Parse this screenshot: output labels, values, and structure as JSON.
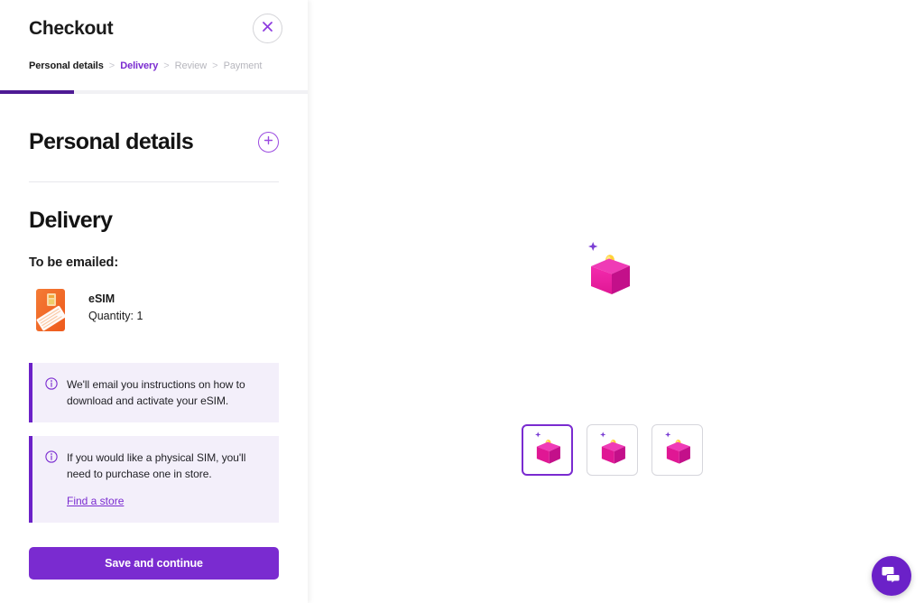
{
  "checkout": {
    "title": "Checkout",
    "close_icon": "close-icon",
    "progress_percent": 24,
    "breadcrumb": [
      {
        "label": "Personal details",
        "state": "done"
      },
      {
        "label": "Delivery",
        "state": "active"
      },
      {
        "label": "Review",
        "state": "pending"
      },
      {
        "label": "Payment",
        "state": "pending"
      }
    ],
    "breadcrumb_separator": ">",
    "personal_details": {
      "heading": "Personal details",
      "expand_icon": "plus-circle-icon"
    },
    "delivery": {
      "heading": "Delivery",
      "to_be_emailed_label": "To be emailed:",
      "product": {
        "thumb_icon": "sim-card-icon",
        "name": "eSIM",
        "quantity_label": "Quantity: 1"
      },
      "info_boxes": [
        {
          "icon": "info-circle-icon",
          "text": "We'll email you instructions on how to download and activate your eSIM."
        },
        {
          "icon": "info-circle-icon",
          "text": "If you would like a physical SIM, you'll need to purchase one in store.",
          "link_label": "Find a store"
        }
      ]
    },
    "save_button_label": "Save and continue"
  },
  "product_stage": {
    "hero_icon": "pink-box-product-image",
    "thumbnails": [
      {
        "icon": "pink-box-product-image",
        "selected": true
      },
      {
        "icon": "pink-box-product-image",
        "selected": false
      },
      {
        "icon": "pink-box-product-image",
        "selected": false
      }
    ]
  },
  "chat_widget": {
    "icon": "chat-bubbles-icon"
  },
  "colors": {
    "brand_purple": "#7A2BD0",
    "deep_purple": "#6B21C8",
    "progress_purple": "#4E1A94",
    "info_bg": "#F3EFFA",
    "text_dark": "#1a1a1a",
    "text_muted": "#b6b6bd",
    "product_pink": "#E8219B",
    "sim_orange": "#F26722"
  }
}
